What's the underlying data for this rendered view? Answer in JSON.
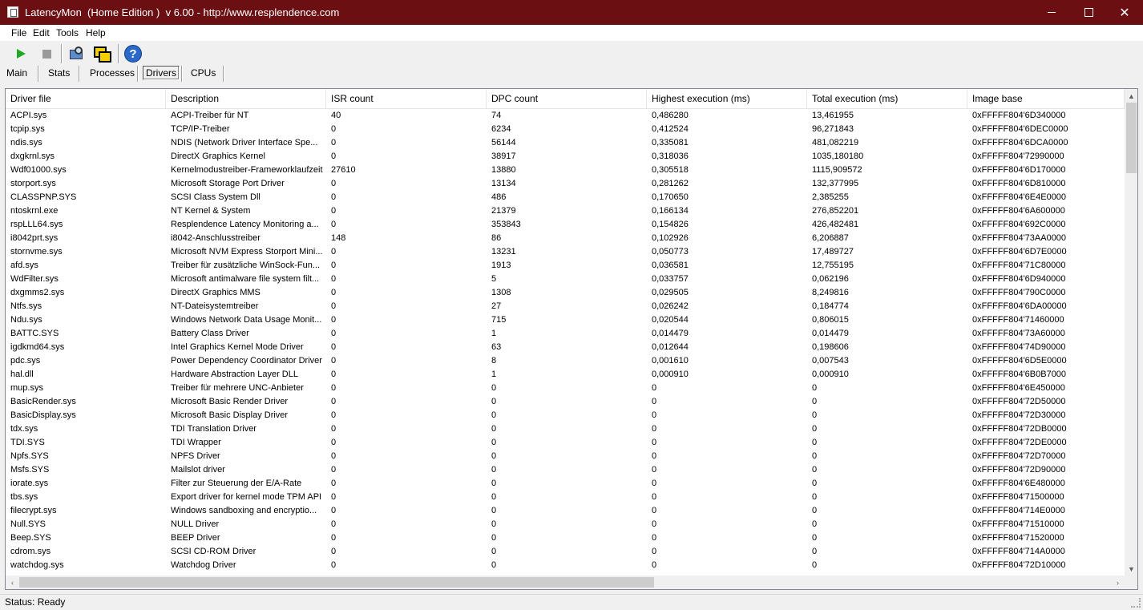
{
  "window": {
    "title": "LatencyMon  (Home Edition )  v 6.00 - http://www.resplendence.com",
    "minimize": "–",
    "maximize": "☐",
    "close": "✕"
  },
  "menu": [
    "File",
    "Edit",
    "Tools",
    "Help"
  ],
  "toolbar": {
    "start": "play-icon",
    "stop": "stop-icon",
    "explore": "search-icon",
    "windows": "windows-icon",
    "help": "?"
  },
  "tabs": [
    "Main",
    "Stats",
    "Processes",
    "Drivers",
    "CPUs"
  ],
  "selected_tab": "Drivers",
  "table": {
    "columns": [
      "Driver file",
      "Description",
      "ISR count",
      "DPC count",
      "Highest execution (ms)",
      "Total execution (ms)",
      "Image base"
    ],
    "rows": [
      [
        "ACPI.sys",
        "ACPI-Treiber für NT",
        "40",
        "74",
        "0,486280",
        "13,461955",
        "0xFFFFF804'6D340000"
      ],
      [
        "tcpip.sys",
        "TCP/IP-Treiber",
        "0",
        "6234",
        "0,412524",
        "96,271843",
        "0xFFFFF804'6DEC0000"
      ],
      [
        "ndis.sys",
        "NDIS (Network Driver Interface Spe...",
        "0",
        "56144",
        "0,335081",
        "481,082219",
        "0xFFFFF804'6DCA0000"
      ],
      [
        "dxgkrnl.sys",
        "DirectX Graphics Kernel",
        "0",
        "38917",
        "0,318036",
        "1035,180180",
        "0xFFFFF804'72990000"
      ],
      [
        "Wdf01000.sys",
        "Kernelmodustreiber-Frameworklaufzeit",
        "27610",
        "13880",
        "0,305518",
        "1115,909572",
        "0xFFFFF804'6D170000"
      ],
      [
        "storport.sys",
        "Microsoft Storage Port Driver",
        "0",
        "13134",
        "0,281262",
        "132,377995",
        "0xFFFFF804'6D810000"
      ],
      [
        "CLASSPNP.SYS",
        "SCSI Class System Dll",
        "0",
        "486",
        "0,170650",
        "2,385255",
        "0xFFFFF804'6E4E0000"
      ],
      [
        "ntoskrnl.exe",
        "NT Kernel & System",
        "0",
        "21379",
        "0,166134",
        "276,852201",
        "0xFFFFF804'6A600000"
      ],
      [
        "rspLLL64.sys",
        "Resplendence Latency Monitoring a...",
        "0",
        "353843",
        "0,154826",
        "426,482481",
        "0xFFFFF804'692C0000"
      ],
      [
        "i8042prt.sys",
        "i8042-Anschlusstreiber",
        "148",
        "86",
        "0,102926",
        "6,206887",
        "0xFFFFF804'73AA0000"
      ],
      [
        "stornvme.sys",
        "Microsoft NVM Express Storport Mini...",
        "0",
        "13231",
        "0,050773",
        "17,489727",
        "0xFFFFF804'6D7E0000"
      ],
      [
        "afd.sys",
        "Treiber für zusätzliche WinSock-Fun...",
        "0",
        "1913",
        "0,036581",
        "12,755195",
        "0xFFFFF804'71C80000"
      ],
      [
        "WdFilter.sys",
        "Microsoft antimalware file system filt...",
        "0",
        "5",
        "0,033757",
        "0,062196",
        "0xFFFFF804'6D940000"
      ],
      [
        "dxgmms2.sys",
        "DirectX Graphics MMS",
        "0",
        "1308",
        "0,029505",
        "8,249816",
        "0xFFFFF804'790C0000"
      ],
      [
        "Ntfs.sys",
        "NT-Dateisystemtreiber",
        "0",
        "27",
        "0,026242",
        "0,184774",
        "0xFFFFF804'6DA00000"
      ],
      [
        "Ndu.sys",
        "Windows Network Data Usage Monit...",
        "0",
        "715",
        "0,020544",
        "0,806015",
        "0xFFFFF804'71460000"
      ],
      [
        "BATTC.SYS",
        "Battery Class Driver",
        "0",
        "1",
        "0,014479",
        "0,014479",
        "0xFFFFF804'73A60000"
      ],
      [
        "igdkmd64.sys",
        "Intel Graphics Kernel Mode Driver",
        "0",
        "63",
        "0,012644",
        "0,198606",
        "0xFFFFF804'74D90000"
      ],
      [
        "pdc.sys",
        "Power Dependency Coordinator Driver",
        "0",
        "8",
        "0,001610",
        "0,007543",
        "0xFFFFF804'6D5E0000"
      ],
      [
        "hal.dll",
        "Hardware Abstraction Layer DLL",
        "0",
        "1",
        "0,000910",
        "0,000910",
        "0xFFFFF804'6B0B7000"
      ],
      [
        "mup.sys",
        "Treiber für mehrere UNC-Anbieter",
        "0",
        "0",
        "0",
        "0",
        "0xFFFFF804'6E450000"
      ],
      [
        "BasicRender.sys",
        "Microsoft Basic Render Driver",
        "0",
        "0",
        "0",
        "0",
        "0xFFFFF804'72D50000"
      ],
      [
        "BasicDisplay.sys",
        "Microsoft Basic Display Driver",
        "0",
        "0",
        "0",
        "0",
        "0xFFFFF804'72D30000"
      ],
      [
        "tdx.sys",
        "TDI Translation Driver",
        "0",
        "0",
        "0",
        "0",
        "0xFFFFF804'72DB0000"
      ],
      [
        "TDI.SYS",
        "TDI Wrapper",
        "0",
        "0",
        "0",
        "0",
        "0xFFFFF804'72DE0000"
      ],
      [
        "Npfs.SYS",
        "NPFS Driver",
        "0",
        "0",
        "0",
        "0",
        "0xFFFFF804'72D70000"
      ],
      [
        "Msfs.SYS",
        "Mailslot driver",
        "0",
        "0",
        "0",
        "0",
        "0xFFFFF804'72D90000"
      ],
      [
        "iorate.sys",
        "Filter zur Steuerung der E/A-Rate",
        "0",
        "0",
        "0",
        "0",
        "0xFFFFF804'6E480000"
      ],
      [
        "tbs.sys",
        "Export driver for kernel mode TPM API",
        "0",
        "0",
        "0",
        "0",
        "0xFFFFF804'71500000"
      ],
      [
        "filecrypt.sys",
        "Windows sandboxing and encryptio...",
        "0",
        "0",
        "0",
        "0",
        "0xFFFFF804'714E0000"
      ],
      [
        "Null.SYS",
        "NULL Driver",
        "0",
        "0",
        "0",
        "0",
        "0xFFFFF804'71510000"
      ],
      [
        "Beep.SYS",
        "BEEP Driver",
        "0",
        "0",
        "0",
        "0",
        "0xFFFFF804'71520000"
      ],
      [
        "cdrom.sys",
        "SCSI CD-ROM Driver",
        "0",
        "0",
        "0",
        "0",
        "0xFFFFF804'714A0000"
      ],
      [
        "watchdog.sys",
        "Watchdog Driver",
        "0",
        "0",
        "0",
        "0",
        "0xFFFFF804'72D10000"
      ]
    ]
  },
  "scroll": {
    "up": "▲",
    "down": "▼",
    "left": "‹",
    "right": "›"
  },
  "status": "Status: Ready"
}
